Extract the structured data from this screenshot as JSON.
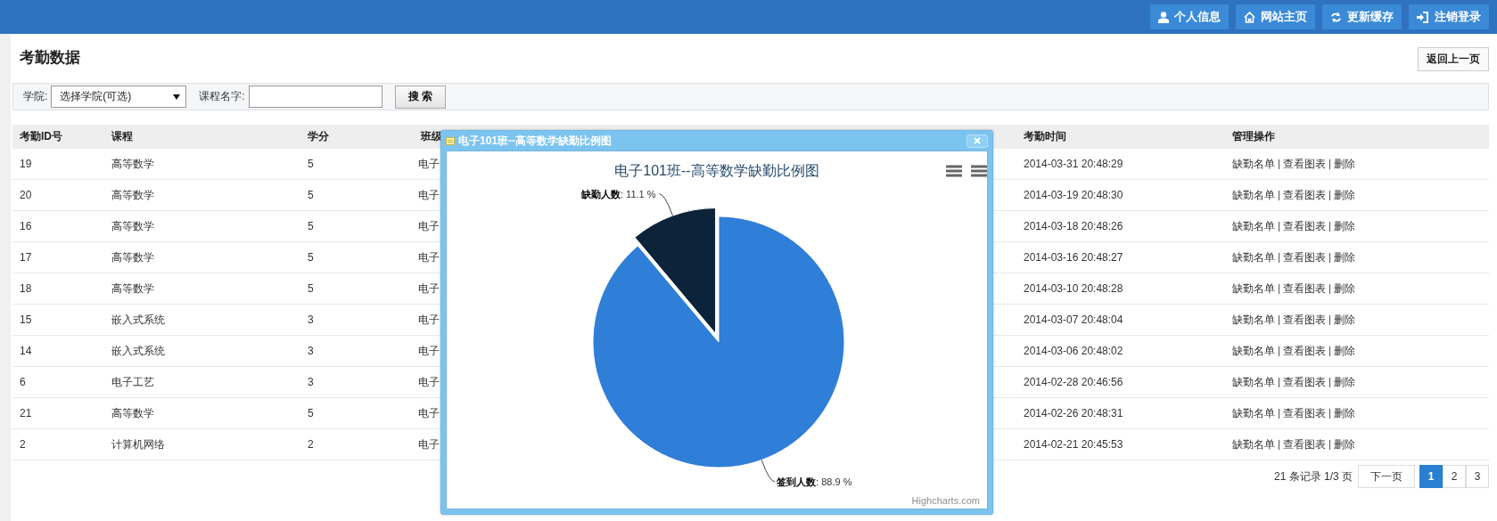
{
  "top_bar": {
    "buttons": [
      {
        "label": "个人信息",
        "kind": "user"
      },
      {
        "label": "网站主页",
        "kind": "home"
      },
      {
        "label": "更新缓存",
        "kind": "refresh"
      },
      {
        "label": "注销登录",
        "kind": "logout"
      }
    ]
  },
  "page": {
    "title": "考勤数据",
    "back_button": "返回上一页"
  },
  "search": {
    "college_label": "学院:",
    "college_value": "选择学院(可选)",
    "course_label": "课程名字:",
    "search_button": "搜 索"
  },
  "table": {
    "columns": [
      "考勤ID号",
      "课程",
      "学分",
      "班级",
      "考勤时间",
      "管理操作"
    ],
    "rows": [
      {
        "id": "19",
        "course": "高等数学",
        "credit": "5",
        "class": "电子",
        "time": "2014-03-31 20:48:29",
        "actions": [
          "缺勤名单",
          "查看图表",
          "删除"
        ]
      },
      {
        "id": "20",
        "course": "高等数学",
        "credit": "5",
        "class": "电子",
        "time": "2014-03-19 20:48:30",
        "actions": [
          "缺勤名单",
          "查看图表",
          "删除"
        ]
      },
      {
        "id": "16",
        "course": "高等数学",
        "credit": "5",
        "class": "电子",
        "time": "2014-03-18 20:48:26",
        "actions": [
          "缺勤名单",
          "查看图表",
          "删除"
        ]
      },
      {
        "id": "17",
        "course": "高等数学",
        "credit": "5",
        "class": "电子",
        "time": "2014-03-16 20:48:27",
        "actions": [
          "缺勤名单",
          "查看图表",
          "删除"
        ]
      },
      {
        "id": "18",
        "course": "高等数学",
        "credit": "5",
        "class": "电子",
        "time": "2014-03-10 20:48:28",
        "actions": [
          "缺勤名单",
          "查看图表",
          "删除"
        ]
      },
      {
        "id": "15",
        "course": "嵌入式系统",
        "credit": "3",
        "class": "电子",
        "time": "2014-03-07 20:48:04",
        "actions": [
          "缺勤名单",
          "查看图表",
          "删除"
        ]
      },
      {
        "id": "14",
        "course": "嵌入式系统",
        "credit": "3",
        "class": "电子",
        "time": "2014-03-06 20:48:02",
        "actions": [
          "缺勤名单",
          "查看图表",
          "删除"
        ]
      },
      {
        "id": "6",
        "course": "电子工艺",
        "credit": "3",
        "class": "电子",
        "time": "2014-02-28 20:46:56",
        "actions": [
          "缺勤名单",
          "查看图表",
          "删除"
        ]
      },
      {
        "id": "21",
        "course": "高等数学",
        "credit": "5",
        "class": "电子",
        "time": "2014-02-26 20:48:31",
        "actions": [
          "缺勤名单",
          "查看图表",
          "删除"
        ]
      },
      {
        "id": "2",
        "course": "计算机网络",
        "credit": "2",
        "class": "电子",
        "time": "2014-02-21 20:45:53",
        "actions": [
          "缺勤名单",
          "查看图表",
          "删除"
        ]
      }
    ]
  },
  "pagination": {
    "summary": "21 条记录 1/3 页",
    "next": "下一页",
    "pages": [
      {
        "label": "1",
        "selected": true
      },
      {
        "label": "2",
        "selected": false
      },
      {
        "label": "3",
        "selected": false
      }
    ]
  },
  "dialog": {
    "title": "电子101班--高等数学缺勤比例图",
    "credit": "Highcharts.com",
    "chart_data": {
      "type": "pie",
      "title": "电子101班--高等数学缺勤比例图",
      "categories": [
        "签到人数",
        "缺勤人数"
      ],
      "values": [
        88.9,
        11.1
      ],
      "value_labels": [
        ": 88.9 %",
        ": 11.1 %"
      ]
    }
  }
}
